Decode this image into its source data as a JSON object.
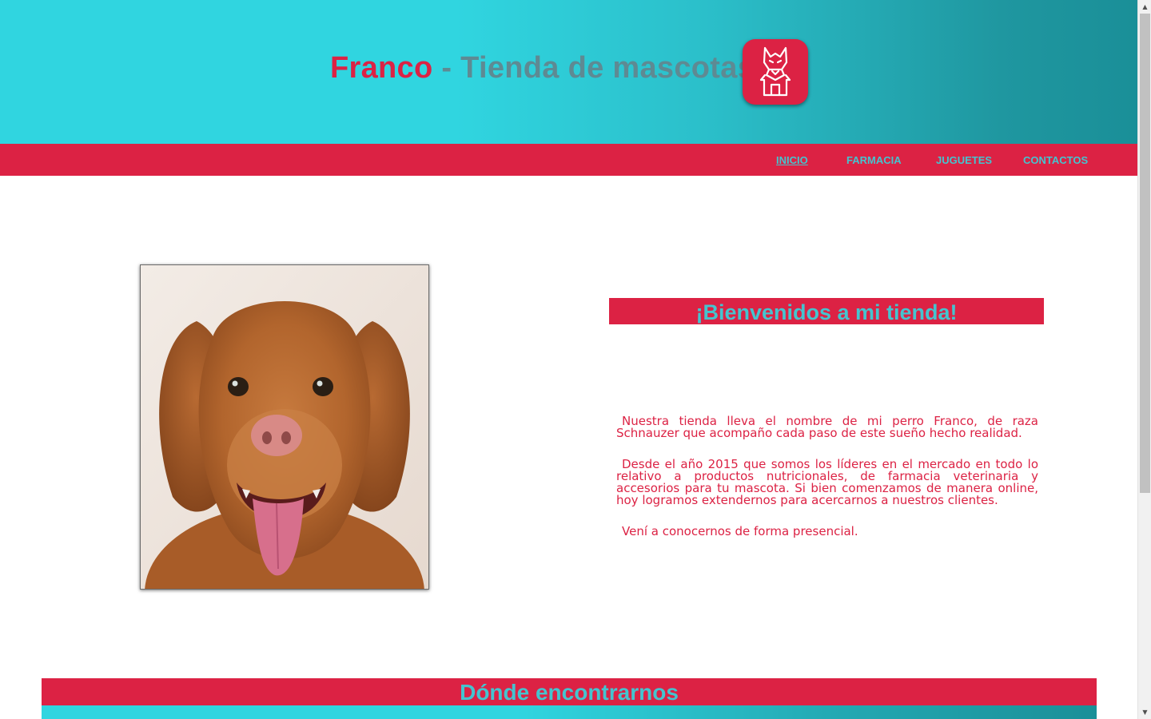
{
  "header": {
    "brand_name": "Franco",
    "brand_rest": " - Tienda de mascotas"
  },
  "logo": {
    "icon": "schnauzer-house-logo-icon"
  },
  "nav": {
    "items": [
      {
        "label": "INICIO",
        "active": true
      },
      {
        "label": "FARMACIA",
        "active": false
      },
      {
        "label": "JUGUETES",
        "active": false
      },
      {
        "label": "CONTACTOS",
        "active": false
      }
    ]
  },
  "hero": {
    "image": "dog-photo",
    "welcome_title": "¡Bienvenidos a mi tienda!",
    "paragraphs": [
      "Nuestra tienda lleva el nombre de mi perro Franco, de raza Schnauzer que acompaño cada paso de este sueño hecho realidad.",
      "Desde el año 2015 que somos los líderes en el mercado en todo lo relativo a productos nutricionales, de farmacia veterinaria y accesorios para tu mascota. Si bien comenzamos de manera online, hoy logramos extendernos para acercarnos a nuestros clientes.",
      "Vení a conocernos de forma presencial."
    ]
  },
  "location": {
    "title": "Dónde encontrarnos"
  },
  "scrollbar": {
    "up_icon": "▲",
    "down_icon": "▼"
  },
  "colors": {
    "accent_red": "#dc2244",
    "accent_cyan": "#30d5e0",
    "nav_text": "#44c4cf",
    "dark_teal": "#1a8f98"
  }
}
